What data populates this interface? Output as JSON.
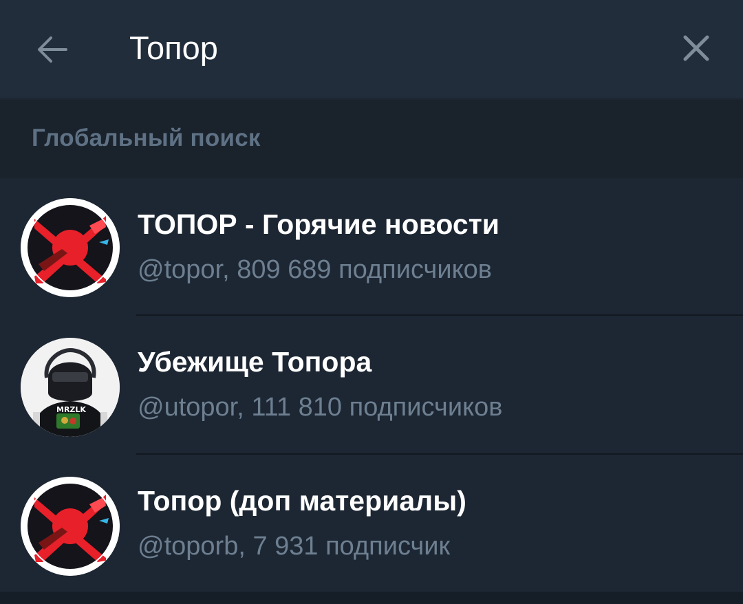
{
  "search": {
    "query": "Топор"
  },
  "section": {
    "title": "Глобальный поиск"
  },
  "results": [
    {
      "title": "ТОПОР - Горячие новости",
      "subtitle": "@topor, 809 689 подписчиков",
      "avatar": "topor-logo"
    },
    {
      "title": "Убежище Топора",
      "subtitle": "@utopor, 111 810 подписчиков",
      "avatar": "person-photo",
      "avatar_text": "MRZLK"
    },
    {
      "title": "Топор (доп материалы)",
      "subtitle": "@toporb, 7 931 подписчик",
      "avatar": "topor-logo"
    }
  ],
  "icons": {
    "back": "arrow-left-icon",
    "close": "close-icon"
  },
  "colors": {
    "topbar": "#212d3b",
    "section_header": "#1a222c",
    "background": "#1d2733",
    "title_text": "#ffffff",
    "subtitle_text": "#6d7f90",
    "logo_red": "#e8202a"
  }
}
